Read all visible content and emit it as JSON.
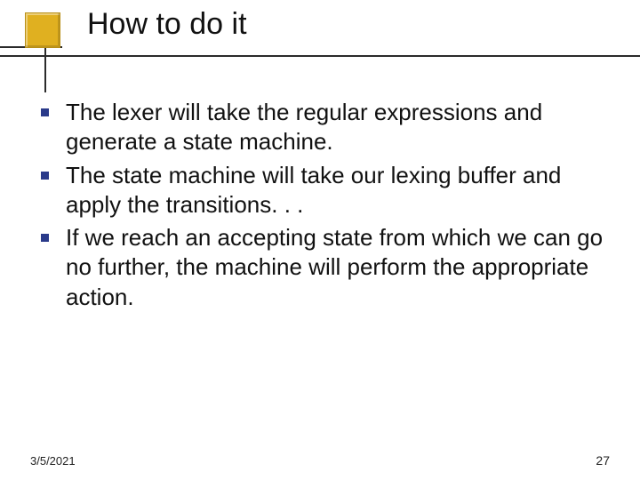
{
  "title": "How to do it",
  "bullets": [
    "The lexer will take the regular expressions and generate a state machine.",
    "The state machine will take our lexing buffer and apply the transitions. . .",
    "If we reach an accepting state from which we can go no further, the machine will perform the appropriate action."
  ],
  "footer": {
    "date": "3/5/2021",
    "page": "27"
  }
}
